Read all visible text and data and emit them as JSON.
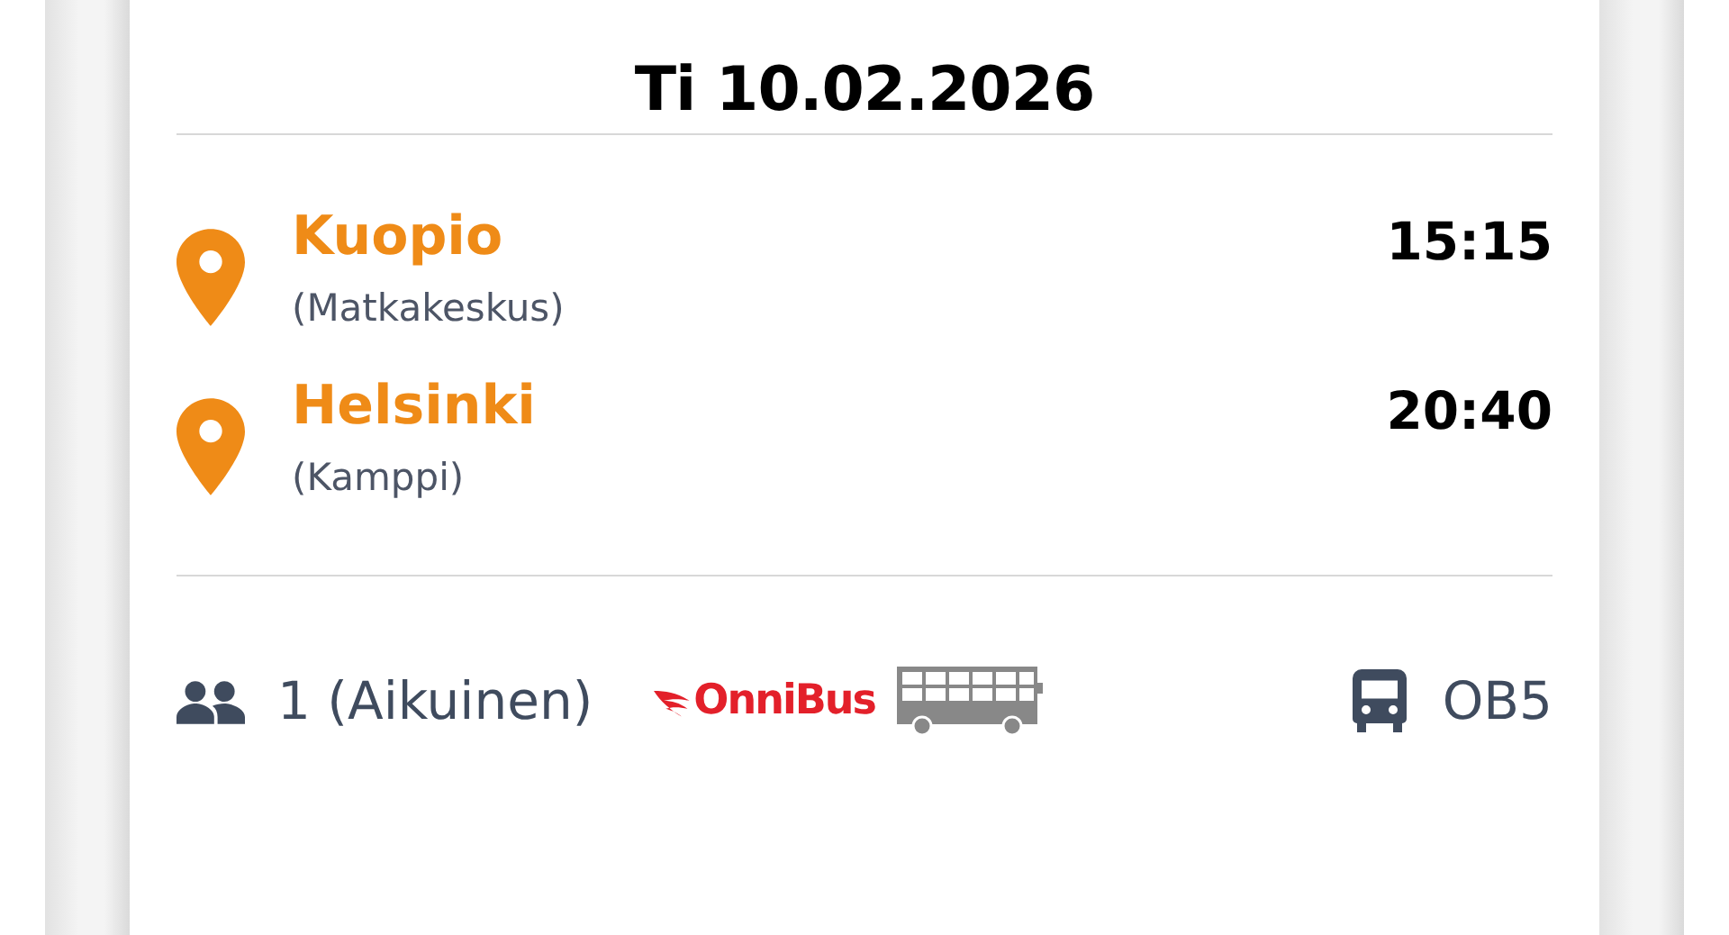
{
  "date": "Ti 10.02.2026",
  "stops": [
    {
      "city": "Kuopio",
      "station": "(Matkakeskus)",
      "time": "15:15"
    },
    {
      "city": "Helsinki",
      "station": "(Kamppi)",
      "time": "20:40"
    }
  ],
  "footer": {
    "passengers": "1 (Aikuinen)",
    "operator_logo": "OnniBus",
    "route": "OB5"
  }
}
